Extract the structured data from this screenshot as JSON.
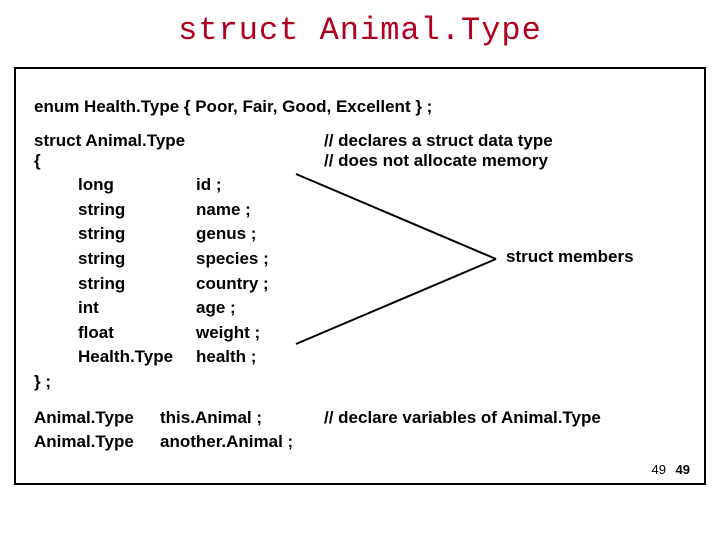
{
  "title": "struct Animal.Type",
  "enum_line": "enum  Health.Type  { Poor,  Fair,  Good,  Excellent } ;",
  "struct_decl": "struct  Animal.Type",
  "struct_open": "{",
  "comment1": "// declares a  struct data type",
  "comment2": "//  does not allocate memory",
  "members": [
    {
      "type": "long",
      "name": "id ;"
    },
    {
      "type": "string",
      "name": "name ;"
    },
    {
      "type": "string",
      "name": "genus ;"
    },
    {
      "type": "string",
      "name": "species ;"
    },
    {
      "type": "string",
      "name": "country ;"
    },
    {
      "type": "int",
      "name": "age ;"
    },
    {
      "type": "float",
      "name": "weight ;"
    },
    {
      "type": "Health.Type",
      "name": "health ;"
    }
  ],
  "struct_close": "} ;",
  "members_label": "struct members",
  "vars": [
    {
      "type": "Animal.Type",
      "name": "this.Animal ;",
      "comment": "// declare  variables of Animal.Type"
    },
    {
      "type": "Animal.Type",
      "name": "another.Animal ;",
      "comment": ""
    }
  ],
  "page_a": "49",
  "page_b": "49"
}
